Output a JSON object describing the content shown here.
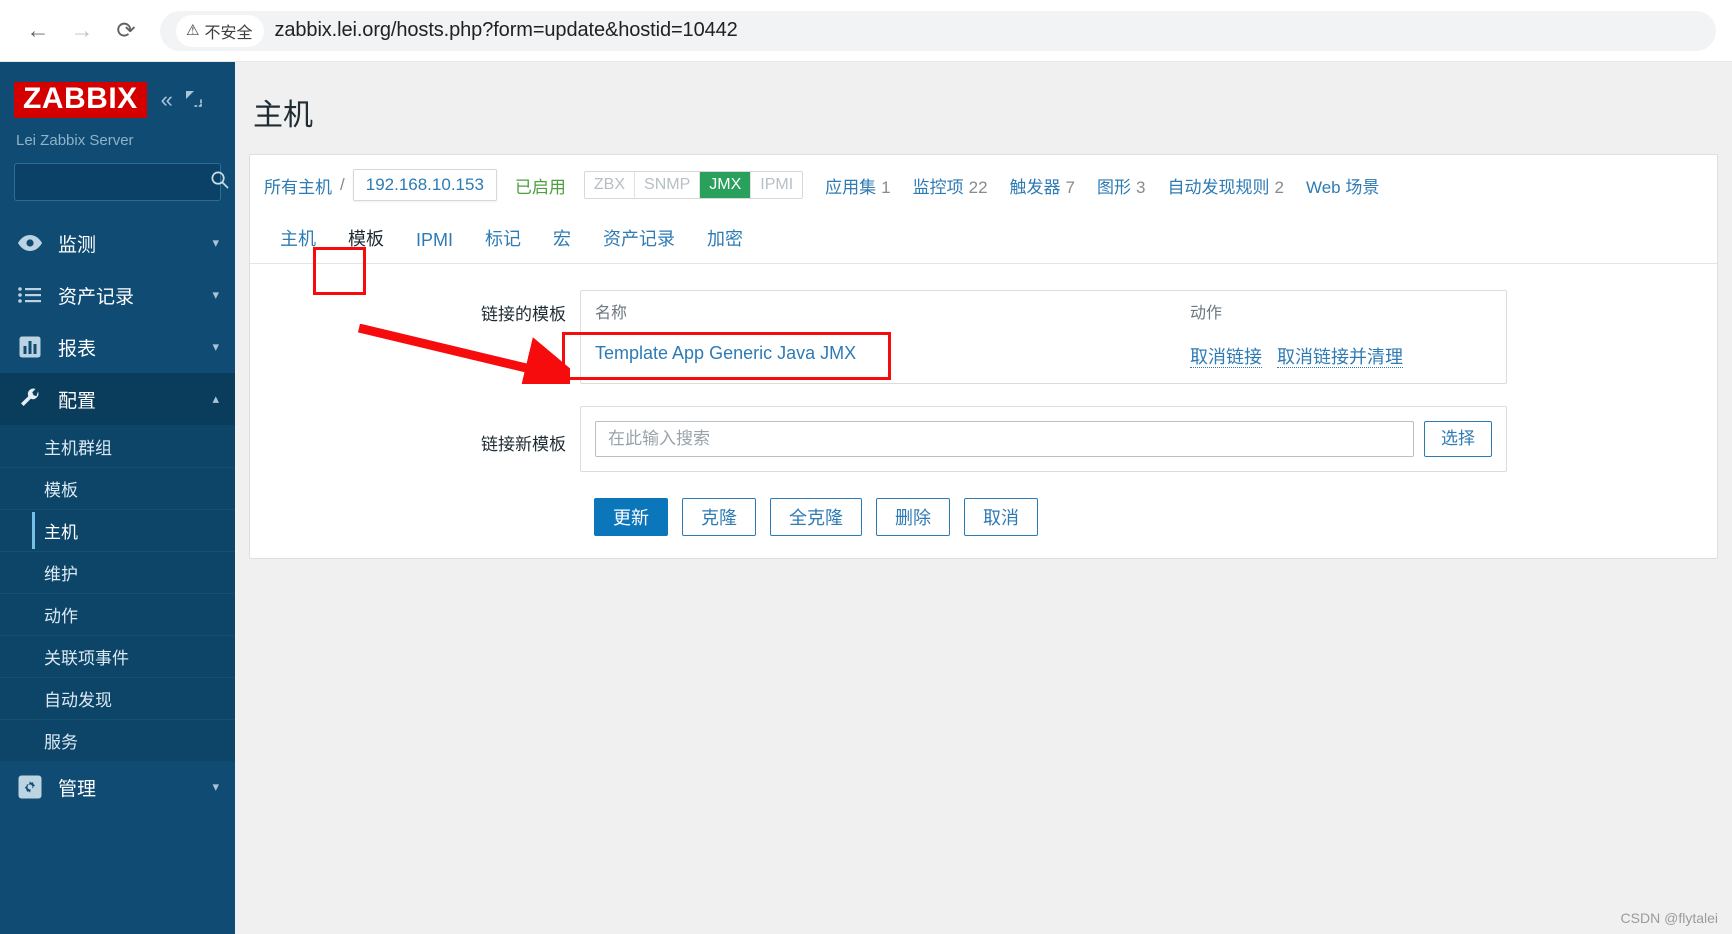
{
  "browser": {
    "back_icon": "back-arrow-icon",
    "forward_icon": "forward-arrow-icon",
    "reload_icon": "reload-icon",
    "security_warning": "不安全",
    "warning_icon": "warning-triangle-icon",
    "url": "zabbix.lei.org/hosts.php?form=update&hostid=10442"
  },
  "sidebar": {
    "logo": "ZABBIX",
    "server_name": "Lei Zabbix Server",
    "collapse_icon": "collapse-chevrons-icon",
    "kiosk_icon": "kiosk-expand-icon",
    "search_placeholder": "",
    "search_value": "",
    "search_icon": "search-icon",
    "menu": [
      {
        "label": "监测",
        "icon": "eye-icon",
        "chevron": "chevron-down-icon",
        "active": false
      },
      {
        "label": "资产记录",
        "icon": "list-icon",
        "chevron": "chevron-down-icon",
        "active": false
      },
      {
        "label": "报表",
        "icon": "bar-chart-icon",
        "chevron": "chevron-down-icon",
        "active": false
      },
      {
        "label": "配置",
        "icon": "wrench-icon",
        "chevron": "chevron-up-icon",
        "active": true
      }
    ],
    "submenu": [
      {
        "label": "主机群组",
        "selected": false
      },
      {
        "label": "模板",
        "selected": false
      },
      {
        "label": "主机",
        "selected": true
      },
      {
        "label": "维护",
        "selected": false
      },
      {
        "label": "动作",
        "selected": false
      },
      {
        "label": "关联项事件",
        "selected": false
      },
      {
        "label": "自动发现",
        "selected": false
      },
      {
        "label": "服务",
        "selected": false
      }
    ],
    "admin": {
      "label": "管理",
      "icon": "gear-icon",
      "chevron": "chevron-down-icon"
    }
  },
  "page": {
    "title": "主机"
  },
  "hostbar": {
    "all_hosts": "所有主机",
    "separator": "/",
    "host_name": "192.168.10.153",
    "status": "已启用",
    "interfaces": [
      {
        "label": "ZBX",
        "active": false
      },
      {
        "label": "SNMP",
        "active": false
      },
      {
        "label": "JMX",
        "active": true
      },
      {
        "label": "IPMI",
        "active": false
      }
    ],
    "counters": [
      {
        "label": "应用集",
        "count": "1"
      },
      {
        "label": "监控项",
        "count": "22"
      },
      {
        "label": "触发器",
        "count": "7"
      },
      {
        "label": "图形",
        "count": "3"
      },
      {
        "label": "自动发现规则",
        "count": "2"
      },
      {
        "label": "Web 场景",
        "count": ""
      }
    ]
  },
  "tabs": [
    {
      "label": "主机",
      "active": false
    },
    {
      "label": "模板",
      "active": true
    },
    {
      "label": "IPMI",
      "active": false
    },
    {
      "label": "标记",
      "active": false
    },
    {
      "label": "宏",
      "active": false
    },
    {
      "label": "资产记录",
      "active": false
    },
    {
      "label": "加密",
      "active": false
    }
  ],
  "form": {
    "linked_templates_label": "链接的模板",
    "table_headers": {
      "name": "名称",
      "action": "动作"
    },
    "linked_templates": [
      {
        "name": "Template App Generic Java JMX",
        "actions": [
          "取消链接",
          "取消链接并清理"
        ]
      }
    ],
    "new_template_label": "链接新模板",
    "new_template_placeholder": "在此输入搜索",
    "new_template_value": "",
    "select_button": "选择"
  },
  "buttons": [
    {
      "label": "更新",
      "primary": true
    },
    {
      "label": "克隆",
      "primary": false
    },
    {
      "label": "全克隆",
      "primary": false
    },
    {
      "label": "删除",
      "primary": false
    },
    {
      "label": "取消",
      "primary": false
    }
  ],
  "watermark": "CSDN @flytalei",
  "colors": {
    "sidebar_bg": "#0f4b73",
    "sidebar_active": "#0a3c5c",
    "brand_red": "#d40000",
    "link_blue": "#2e7bb4",
    "primary_blue": "#0b76ba",
    "status_green": "#4f9e3f",
    "jmx_green": "#29a05b",
    "annotation_red": "#f60c0c"
  }
}
